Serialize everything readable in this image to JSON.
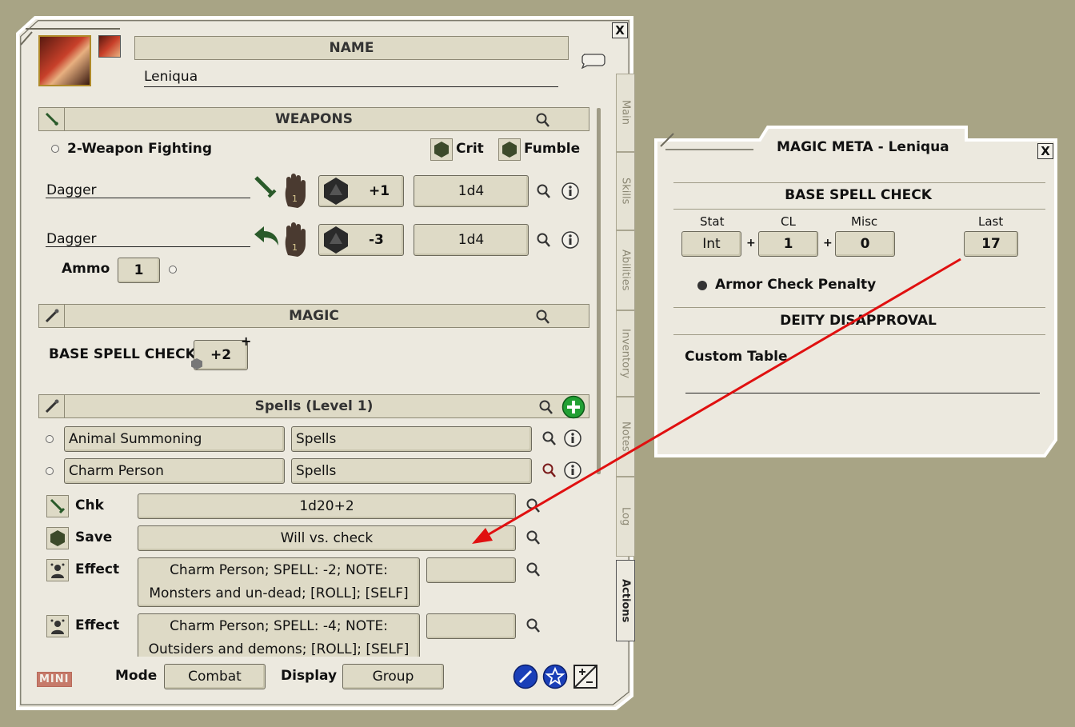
{
  "charsheet": {
    "name_label": "NAME",
    "name_value": "Leniqua",
    "close_label": "X",
    "weapons": {
      "header": "WEAPONS",
      "two_weapon_label": "2-Weapon Fighting",
      "crit_label": "Crit",
      "fumble_label": "Fumble",
      "rows": [
        {
          "name": "Dagger",
          "attack": "+1",
          "damage": "1d4",
          "hand": "1"
        },
        {
          "name": "Dagger",
          "attack": "-3",
          "damage": "1d4",
          "hand": "1"
        }
      ],
      "ammo_label": "Ammo",
      "ammo_value": "1"
    },
    "magic": {
      "header": "MAGIC",
      "base_spell_check_label": "BASE SPELL CHECK",
      "base_spell_check_value": "+2"
    },
    "spells": {
      "header": "Spells (Level 1)",
      "rows": [
        {
          "name": "Animal Summoning",
          "group": "Spells"
        },
        {
          "name": "Charm Person",
          "group": "Spells"
        }
      ],
      "actions": [
        {
          "label": "Chk",
          "value": "1d20+2"
        },
        {
          "label": "Save",
          "value": "Will vs. check"
        },
        {
          "label": "Effect",
          "line1": "Charm Person; SPELL: -2; NOTE:",
          "line2": "Monsters and un-dead; [ROLL]; [SELF]",
          "extra": ""
        },
        {
          "label": "Effect",
          "line1": "Charm Person; SPELL: -4; NOTE:",
          "line2": "Outsiders and demons; [ROLL]; [SELF]",
          "extra": ""
        }
      ]
    },
    "tabs": [
      "Main",
      "Skills",
      "Abilities",
      "Inventory",
      "Notes",
      "Log",
      "Actions"
    ],
    "footer": {
      "mini_label": "MINI",
      "mode_label": "Mode",
      "mode_value": "Combat",
      "display_label": "Display",
      "display_value": "Group"
    }
  },
  "magicmeta": {
    "title": "MAGIC META - Leniqua",
    "close_label": "X",
    "section1": "BASE SPELL CHECK",
    "stat_label": "Stat",
    "stat_value": "Int",
    "cl_label": "CL",
    "cl_value": "1",
    "misc_label": "Misc",
    "misc_value": "0",
    "last_label": "Last",
    "last_value": "17",
    "plus": "+",
    "armor_check_label": "Armor Check Penalty",
    "section2": "DEITY DISAPPROVAL",
    "custom_table_label": "Custom Table",
    "custom_table_value": ""
  },
  "colors": {
    "background": "#a8a485",
    "panel": "#ece9df",
    "field": "#dedac6",
    "arrow": "#e01010",
    "add_button": "#22a034",
    "action_icon_blue": "#1a3fb8"
  }
}
